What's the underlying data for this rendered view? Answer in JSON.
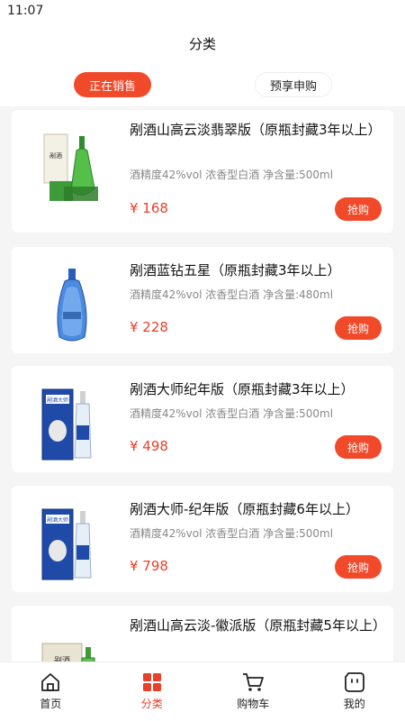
{
  "status": {
    "time": "11:07"
  },
  "header": {
    "title": "分类"
  },
  "tabs": [
    {
      "label": "正在销售",
      "active": true
    },
    {
      "label": "预享申购",
      "active": false
    }
  ],
  "products": [
    {
      "title": "剐酒山高云淡翡翠版（原瓶封藏3年以上）",
      "spec": "酒精度42%vol 浓香型白酒  净含量:500ml",
      "price": "¥ 168",
      "buy_label": "抢购",
      "image_icon": "jade-bottle-with-box"
    },
    {
      "title": "剐酒蓝钻五星（原瓶封藏3年以上）",
      "spec": "酒精度42%vol 浓香型白酒  净含量:480ml",
      "price": "¥ 228",
      "buy_label": "抢购",
      "image_icon": "blue-bottle"
    },
    {
      "title": "剐酒大师纪年版（原瓶封藏3年以上）",
      "spec": "酒精度42%vol 浓香型白酒  净含量:500ml",
      "price": "¥ 498",
      "buy_label": "抢购",
      "image_icon": "blue-box-with-bottle"
    },
    {
      "title": "剐酒大师-纪年版（原瓶封藏6年以上）",
      "spec": "酒精度42%vol 浓香型白酒  净含量:500ml",
      "price": "¥ 798",
      "buy_label": "抢购",
      "image_icon": "blue-box-with-bottle"
    },
    {
      "title": "剐酒山高云淡-徽派版（原瓶封藏5年以上）",
      "image_icon": "beige-box-with-bottle"
    }
  ],
  "nav": [
    {
      "label": "首页",
      "icon": "home-icon",
      "active": false
    },
    {
      "label": "分类",
      "icon": "category-icon",
      "active": true
    },
    {
      "label": "购物车",
      "icon": "cart-icon",
      "active": false
    },
    {
      "label": "我的",
      "icon": "profile-icon",
      "active": false
    }
  ],
  "colors": {
    "accent": "#f04a2a",
    "price": "#e8402a"
  }
}
